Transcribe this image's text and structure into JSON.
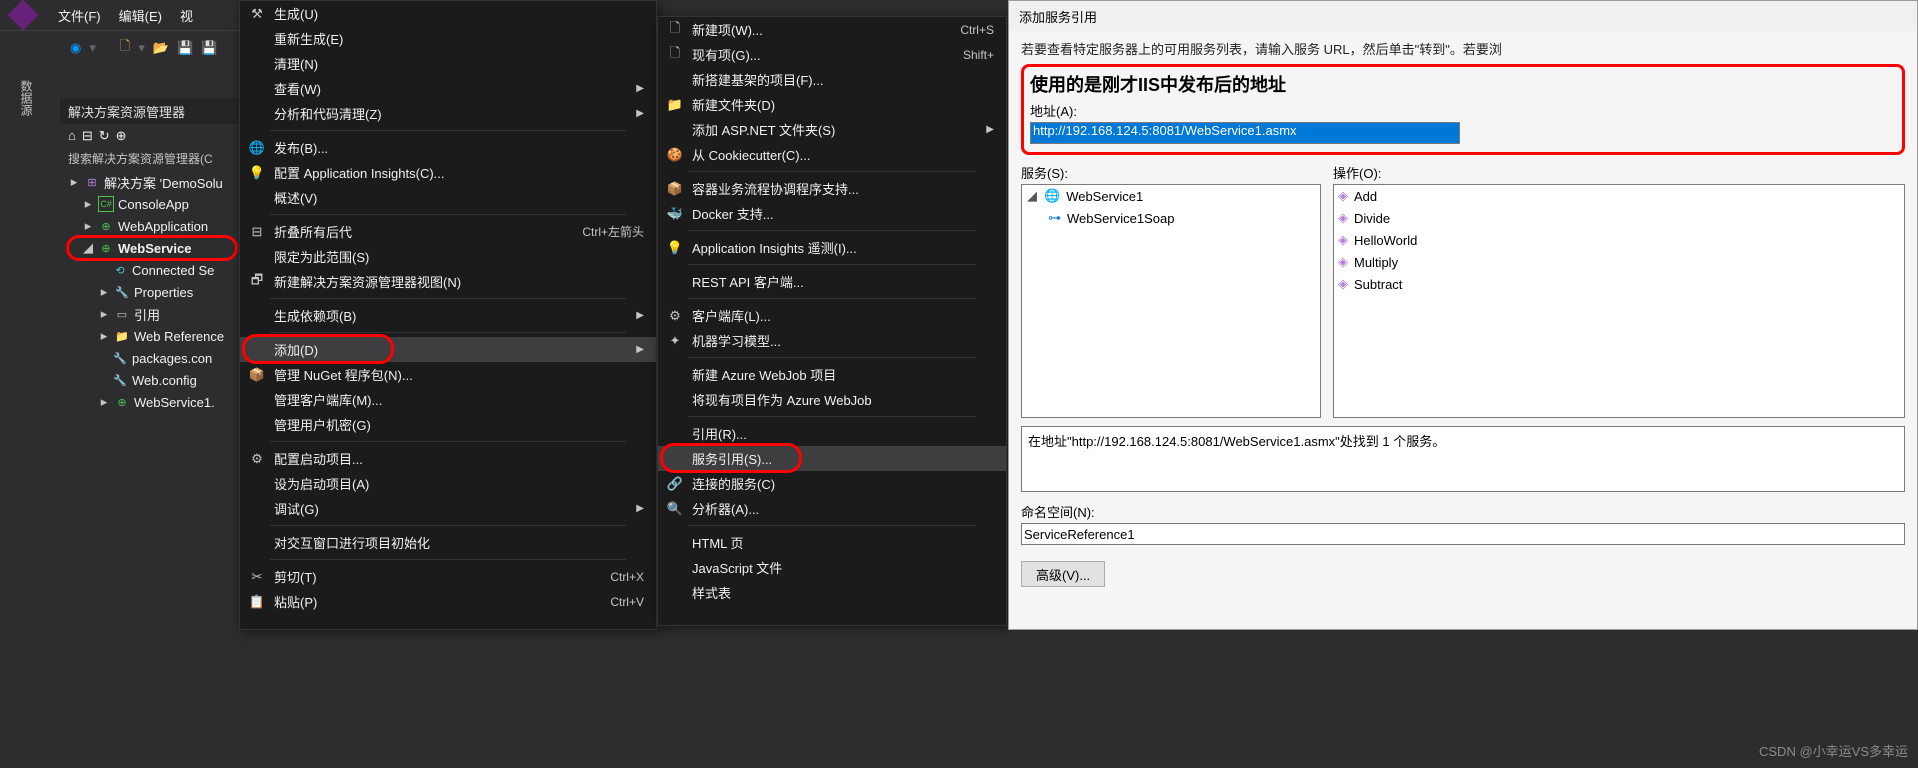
{
  "topbar": {
    "file": "文件(F)",
    "edit": "编辑(E)",
    "view": "视"
  },
  "side_tab": "数据源",
  "panel": {
    "title": "解决方案资源管理器",
    "search": "搜索解决方案资源管理器(C",
    "solution": "解决方案 'DemoSolu",
    "items": [
      "ConsoleApp",
      "WebApplication",
      "WebService"
    ],
    "sub": [
      "Connected Se",
      "Properties",
      "引用",
      "Web Reference",
      "packages.con",
      "Web.config",
      "WebService1."
    ]
  },
  "menu1": [
    {
      "icon": "hammer",
      "t": "生成(U)"
    },
    {
      "t": "重新生成(E)"
    },
    {
      "t": "清理(N)"
    },
    {
      "t": "查看(W)",
      "arrow": true
    },
    {
      "t": "分析和代码清理(Z)",
      "arrow": true
    },
    {
      "sep": true
    },
    {
      "icon": "globe",
      "t": "发布(B)..."
    },
    {
      "icon": "bulb",
      "t": "配置 Application Insights(C)..."
    },
    {
      "t": "概述(V)"
    },
    {
      "sep": true
    },
    {
      "icon": "collapse",
      "t": "折叠所有后代",
      "short": "Ctrl+左箭头"
    },
    {
      "t": "限定为此范围(S)"
    },
    {
      "icon": "newview",
      "t": "新建解决方案资源管理器视图(N)"
    },
    {
      "sep": true
    },
    {
      "t": "生成依赖项(B)",
      "arrow": true
    },
    {
      "sep": true
    },
    {
      "t": "添加(D)",
      "arrow": true,
      "hover": true,
      "red": true
    },
    {
      "icon": "nuget",
      "t": "管理 NuGet 程序包(N)..."
    },
    {
      "t": "管理客户端库(M)..."
    },
    {
      "t": "管理用户机密(G)"
    },
    {
      "sep": true
    },
    {
      "icon": "gear",
      "t": "配置启动项目..."
    },
    {
      "t": "设为启动项目(A)"
    },
    {
      "t": "调试(G)",
      "arrow": true
    },
    {
      "sep": true
    },
    {
      "t": "对交互窗口进行项目初始化"
    },
    {
      "sep": true
    },
    {
      "icon": "cut",
      "t": "剪切(T)",
      "short": "Ctrl+X"
    },
    {
      "icon": "paste",
      "t": "粘贴(P)",
      "short": "Ctrl+V"
    }
  ],
  "menu2": [
    {
      "icon": "file",
      "t": "新建项(W)...",
      "short": "Ctrl+S"
    },
    {
      "icon": "file",
      "t": "现有项(G)...",
      "short": "Shift+"
    },
    {
      "t": "新搭建基架的项目(F)..."
    },
    {
      "icon": "folder",
      "t": "新建文件夹(D)"
    },
    {
      "t": "添加 ASP.NET 文件夹(S)",
      "arrow": true
    },
    {
      "icon": "cookie",
      "t": "从 Cookiecutter(C)..."
    },
    {
      "sep": true
    },
    {
      "icon": "container",
      "t": "容器业务流程协调程序支持..."
    },
    {
      "icon": "docker",
      "t": "Docker 支持..."
    },
    {
      "sep": true
    },
    {
      "icon": "bulb",
      "t": "Application Insights 遥测(I)..."
    },
    {
      "sep": true
    },
    {
      "t": "REST API 客户端..."
    },
    {
      "sep": true
    },
    {
      "icon": "gear",
      "t": "客户端库(L)..."
    },
    {
      "icon": "ml",
      "t": "机器学习模型..."
    },
    {
      "sep": true
    },
    {
      "t": "新建 Azure WebJob 项目"
    },
    {
      "t": "将现有项目作为 Azure WebJob"
    },
    {
      "sep": true
    },
    {
      "t": "引用(R)..."
    },
    {
      "t": "服务引用(S)...",
      "hover": true,
      "red": true
    },
    {
      "icon": "connect",
      "t": "连接的服务(C)"
    },
    {
      "icon": "analyze",
      "t": "分析器(A)..."
    },
    {
      "sep": true
    },
    {
      "t": "HTML 页"
    },
    {
      "t": "JavaScript 文件"
    },
    {
      "t": "样式表"
    }
  ],
  "dialog": {
    "title": "添加服务引用",
    "hint": "若要查看特定服务器上的可用服务列表，请输入服务 URL，然后单击\"转到\"。若要浏",
    "heading": "使用的是刚才IIS中发布后的地址",
    "addr_label": "地址(A):",
    "addr_value": "http://192.168.124.5:8081/WebService1.asmx",
    "services_label": "服务(S):",
    "ops_label": "操作(O):",
    "svc_root": "WebService1",
    "svc_child": "WebService1Soap",
    "ops": [
      "Add",
      "Divide",
      "HelloWorld",
      "Multiply",
      "Subtract"
    ],
    "status": "在地址\"http://192.168.124.5:8081/WebService1.asmx\"处找到 1 个服务。",
    "ns_label": "命名空间(N):",
    "ns_value": "ServiceReference1",
    "advanced": "高级(V)..."
  },
  "watermark": "CSDN @小幸运VS多幸运"
}
